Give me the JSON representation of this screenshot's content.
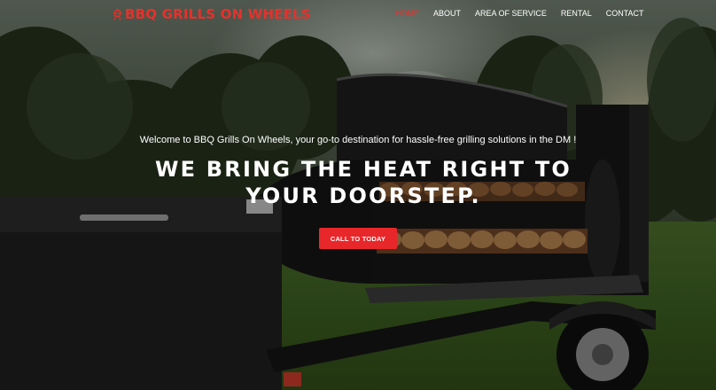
{
  "brand": {
    "name": "BBQ GRILLS ON WHEELS",
    "icon": "grill-icon",
    "color": "#e8302b"
  },
  "nav": {
    "items": [
      {
        "label": "HOME",
        "active": true
      },
      {
        "label": "ABOUT",
        "active": false
      },
      {
        "label": "AREA OF SERVICE",
        "active": false
      },
      {
        "label": "RENTAL",
        "active": false
      },
      {
        "label": "CONTACT",
        "active": false
      }
    ]
  },
  "hero": {
    "welcome": "Welcome to BBQ Grills On Wheels, your go-to destination for hassle-free grilling solutions in the DM !",
    "headline": "WE BRING THE HEAT RIGHT TO YOUR DOORSTEP.",
    "cta_label": "CALL TO TODAY"
  },
  "colors": {
    "accent": "#e8272a",
    "text": "#ffffff"
  }
}
